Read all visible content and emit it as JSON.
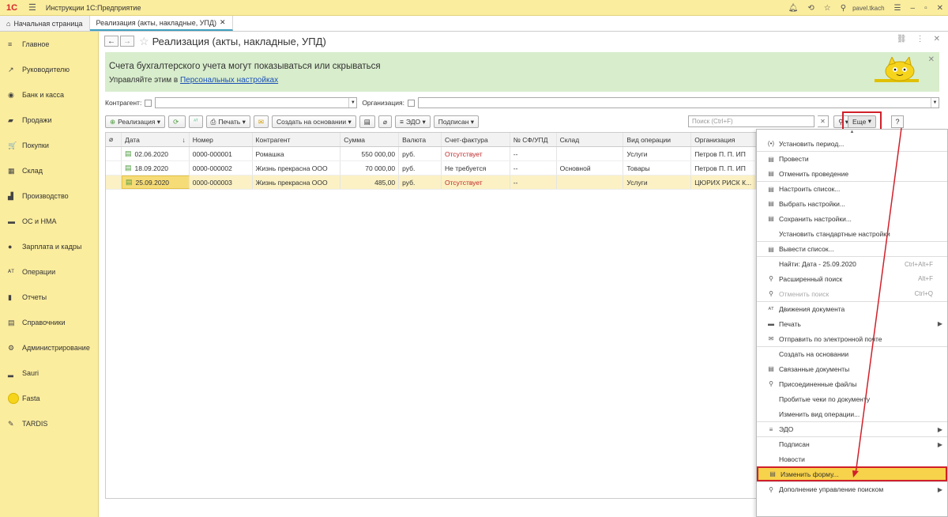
{
  "titlebar": {
    "logo": "1С",
    "title": "Инструкции 1С:Предприятие",
    "user": "pavel.tkach"
  },
  "tabs": [
    {
      "label": "Начальная страница"
    },
    {
      "label": "Реализация (акты, накладные, УПД)"
    }
  ],
  "sidebar": {
    "items": [
      {
        "icon": "≡",
        "label": "Главное"
      },
      {
        "icon": "↗",
        "label": "Руководителю"
      },
      {
        "icon": "◉",
        "label": "Банк и касса"
      },
      {
        "icon": "▰",
        "label": "Продажи"
      },
      {
        "icon": "🛒",
        "label": "Покупки"
      },
      {
        "icon": "▦",
        "label": "Склад"
      },
      {
        "icon": "▟",
        "label": "Производство"
      },
      {
        "icon": "▬",
        "label": "ОС и НМА"
      },
      {
        "icon": "●",
        "label": "Зарплата и кадры"
      },
      {
        "icon": "ᴬᵀ",
        "label": "Операции"
      },
      {
        "icon": "▮",
        "label": "Отчеты"
      },
      {
        "icon": "▤",
        "label": "Справочники"
      },
      {
        "icon": "⚙",
        "label": "Администрирование"
      },
      {
        "icon": "▂",
        "label": "Sauri"
      },
      {
        "icon": "",
        "label": "Fasta"
      },
      {
        "icon": "✎",
        "label": "TARDIS"
      }
    ]
  },
  "page": {
    "title": "Реализация (акты, накладные, УПД)"
  },
  "banner": {
    "line1": "Счета бухгалтерского учета могут показываться или скрываться",
    "line2_prefix": "Управляйте этим в ",
    "line2_link": "Персональных настройках"
  },
  "filter": {
    "kontragent_label": "Контрагент:",
    "organization_label": "Организация:"
  },
  "toolbar": {
    "realization": "Реализация",
    "print": "Печать",
    "create_based": "Создать на основании",
    "edo": "ЭДО",
    "signed": "Подписан",
    "search_placeholder": "Поиск (Ctrl+F)",
    "more": "Еще",
    "help": "?"
  },
  "table": {
    "headers": [
      "Дата",
      "Номер",
      "Контрагент",
      "Сумма",
      "Валюта",
      "Счет-фактура",
      "№ СФ/УПД",
      "Склад",
      "Вид операции",
      "Организация"
    ],
    "rows": [
      {
        "date": "02.06.2020",
        "number": "0000-000001",
        "kontragent": "Ромашка",
        "sum": "550 000,00",
        "currency": "руб.",
        "invoice": "Отсутствует",
        "sf": "--",
        "warehouse": "",
        "operation": "Услуги",
        "org": "Петров П. П. ИП"
      },
      {
        "date": "18.09.2020",
        "number": "0000-000002",
        "kontragent": "Жизнь прекрасна ООО",
        "sum": "70 000,00",
        "currency": "руб.",
        "invoice": "Не требуется",
        "sf": "--",
        "warehouse": "Основной",
        "operation": "Товары",
        "org": "Петров П. П. ИП"
      },
      {
        "date": "25.09.2020",
        "number": "0000-000003",
        "kontragent": "Жизнь прекрасна ООО",
        "sum": "485,00",
        "currency": "руб.",
        "invoice": "Отсутствует",
        "sf": "--",
        "warehouse": "",
        "operation": "Услуги",
        "org": "ЦЮРИХ РИСК К..."
      }
    ]
  },
  "menu": {
    "items": [
      {
        "label": "Установить период...",
        "icon": "(•)"
      },
      {
        "label": "Провести",
        "icon": "▤"
      },
      {
        "label": "Отменить проведение",
        "icon": "▤"
      },
      {
        "label": "Настроить список...",
        "icon": "▤"
      },
      {
        "label": "Выбрать настройки...",
        "icon": "▤"
      },
      {
        "label": "Сохранить настройки...",
        "icon": "▤"
      },
      {
        "label": "Установить стандартные настройки",
        "icon": ""
      },
      {
        "label": "Вывести список...",
        "icon": "▤"
      },
      {
        "label": "Найти: Дата - 25.09.2020",
        "icon": "",
        "shortcut": "Ctrl+Alt+F"
      },
      {
        "label": "Расширенный поиск",
        "icon": "⚲",
        "shortcut": "Alt+F"
      },
      {
        "label": "Отменить поиск",
        "icon": "⚲",
        "shortcut": "Ctrl+Q"
      },
      {
        "label": "Движения документа",
        "icon": "ᴬᵀ"
      },
      {
        "label": "Печать",
        "icon": "▬"
      },
      {
        "label": "Отправить по электронной почте",
        "icon": "✉"
      },
      {
        "label": "Создать на основании",
        "icon": ""
      },
      {
        "label": "Связанные документы",
        "icon": "▤"
      },
      {
        "label": "Присоединенные файлы",
        "icon": "⚲"
      },
      {
        "label": "Пробитые чеки по документу",
        "icon": ""
      },
      {
        "label": "Изменить вид операции...",
        "icon": ""
      },
      {
        "label": "ЭДО",
        "icon": "≡"
      },
      {
        "label": "Подписан",
        "icon": ""
      },
      {
        "label": "Новости",
        "icon": ""
      },
      {
        "label": "Изменить форму...",
        "icon": "▤"
      },
      {
        "label": "Дополнение управление поиском",
        "icon": "⚲"
      }
    ]
  },
  "colors": {
    "accent": "#fbed9e",
    "highlight": "#f7d24b",
    "annotation": "#d0202a",
    "banner": "#d8edcc"
  }
}
